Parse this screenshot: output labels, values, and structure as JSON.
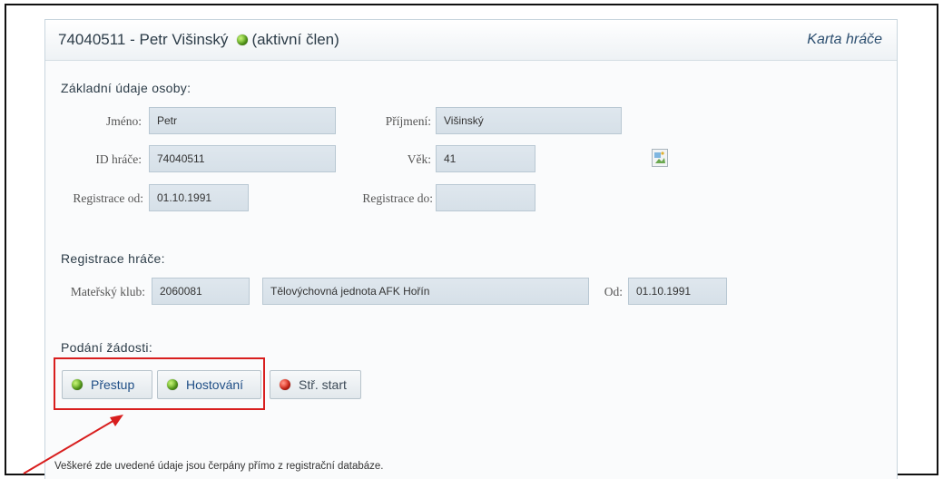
{
  "header": {
    "id_name": "74040511 - Petr Višinský",
    "status_label": "(aktivní člen)",
    "card_link": "Karta hráče"
  },
  "personal": {
    "section_title": "Základní údaje osoby:",
    "first_name_label": "Jméno:",
    "first_name": "Petr",
    "last_name_label": "Příjmení:",
    "last_name": "Višinský",
    "player_id_label": "ID hráče:",
    "player_id": "74040511",
    "age_label": "Věk:",
    "age": "41",
    "reg_from_label": "Registrace od:",
    "reg_from": "01.10.1991",
    "reg_to_label": "Registrace do:",
    "reg_to": ""
  },
  "registration": {
    "section_title": "Registrace hráče:",
    "club_label": "Mateřský klub:",
    "club_code": "2060081",
    "club_name": "Tělovýchovná jednota AFK Hořín",
    "since_label": "Od:",
    "since": "01.10.1991"
  },
  "requests": {
    "section_title": "Podání žádosti:",
    "buttons": [
      {
        "label": "Přestup",
        "status": "green"
      },
      {
        "label": "Hostování",
        "status": "green"
      },
      {
        "label": "Stř. start",
        "status": "red"
      }
    ]
  },
  "footnote": "Veškeré zde uvedené údaje jsou čerpány přímo z registrační databáze.",
  "colors": {
    "active": "#5fae1e",
    "inactive": "#e42a1a",
    "annotation": "#d81e1e"
  }
}
